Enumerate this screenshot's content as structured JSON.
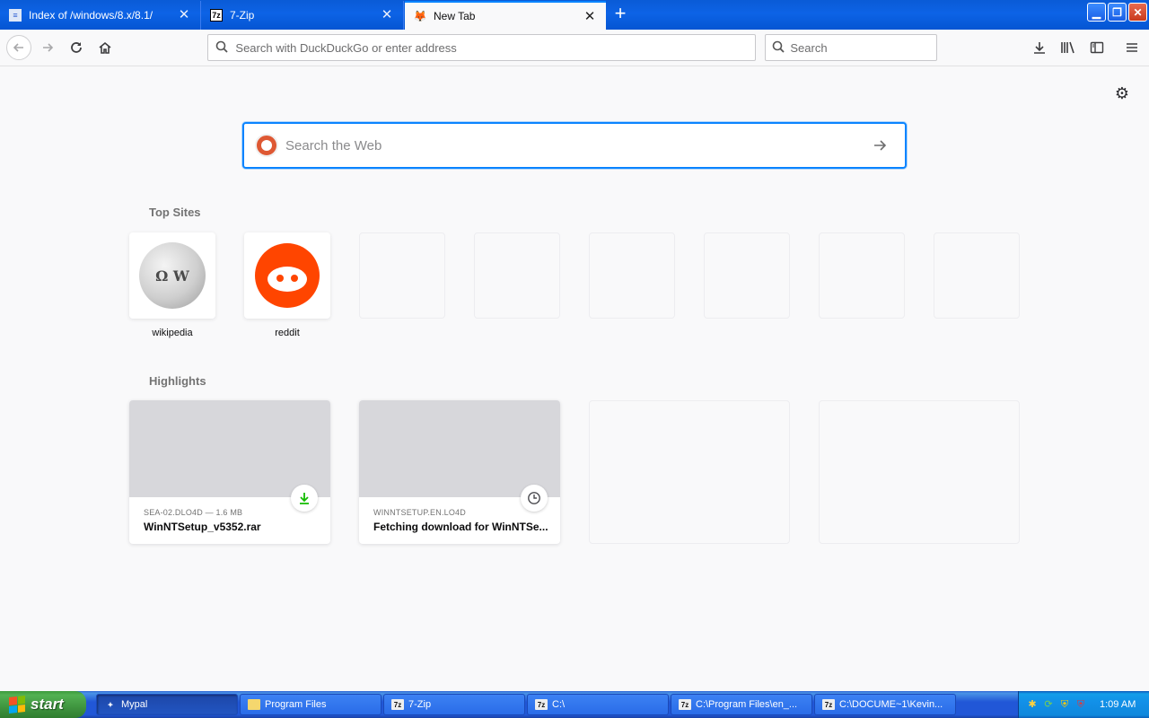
{
  "tabs": [
    {
      "title": "Index of /windows/8.x/8.1/",
      "favicon": "page-icon",
      "active": false
    },
    {
      "title": "7-Zip",
      "favicon": "7zip-icon",
      "active": false
    },
    {
      "title": "New Tab",
      "favicon": "firefox-icon",
      "active": true
    }
  ],
  "tab_favicon_text": {
    "sevenzip": "7z"
  },
  "window_controls": {
    "minimize": "▁",
    "maximize": "❐",
    "close": "✕"
  },
  "toolbar": {
    "url_placeholder": "Search with DuckDuckGo or enter address",
    "search_placeholder": "Search"
  },
  "newtab": {
    "web_search_placeholder": "Search the Web",
    "top_sites_title": "Top Sites",
    "top_sites": [
      {
        "label": "wikipedia",
        "icon": "wikipedia-globe-icon"
      },
      {
        "label": "reddit",
        "icon": "reddit-snoo-icon"
      },
      {
        "label": ""
      },
      {
        "label": ""
      },
      {
        "label": ""
      },
      {
        "label": ""
      },
      {
        "label": ""
      },
      {
        "label": ""
      }
    ],
    "highlights_title": "Highlights",
    "highlights": [
      {
        "context": "SEA-02.DLO4D — 1.6 MB",
        "title": "WinNTSetup_v5352.rar",
        "badge": "download-icon"
      },
      {
        "context": "WINNTSETUP.EN.LO4D",
        "title": "Fetching download for WinNTSe...",
        "badge": "clock-icon"
      }
    ],
    "wiki_glyph": "Ω W"
  },
  "taskbar": {
    "start_label": "start",
    "tasks": [
      {
        "label": "Mypal",
        "icon": "mypal-icon",
        "active": true
      },
      {
        "label": "Program Files",
        "icon": "folder-icon",
        "active": false
      },
      {
        "label": "7-Zip",
        "icon": "7zip-icon",
        "active": false
      },
      {
        "label": "C:\\",
        "icon": "7zip-icon",
        "active": false
      },
      {
        "label": "C:\\Program Files\\en_...",
        "icon": "7zip-icon",
        "active": false
      },
      {
        "label": "C:\\DOCUME~1\\Kevin...",
        "icon": "7zip-icon",
        "active": false
      }
    ],
    "task_icon_text": "7z",
    "clock": "1:09 AM"
  },
  "colors": {
    "xp_blue": "#0d63e6",
    "focus_ring": "#0a84ff",
    "reddit": "#ff4500",
    "duckduckgo": "#de5833",
    "start_green": "#3b8e3b",
    "download_green": "#12bc00"
  }
}
